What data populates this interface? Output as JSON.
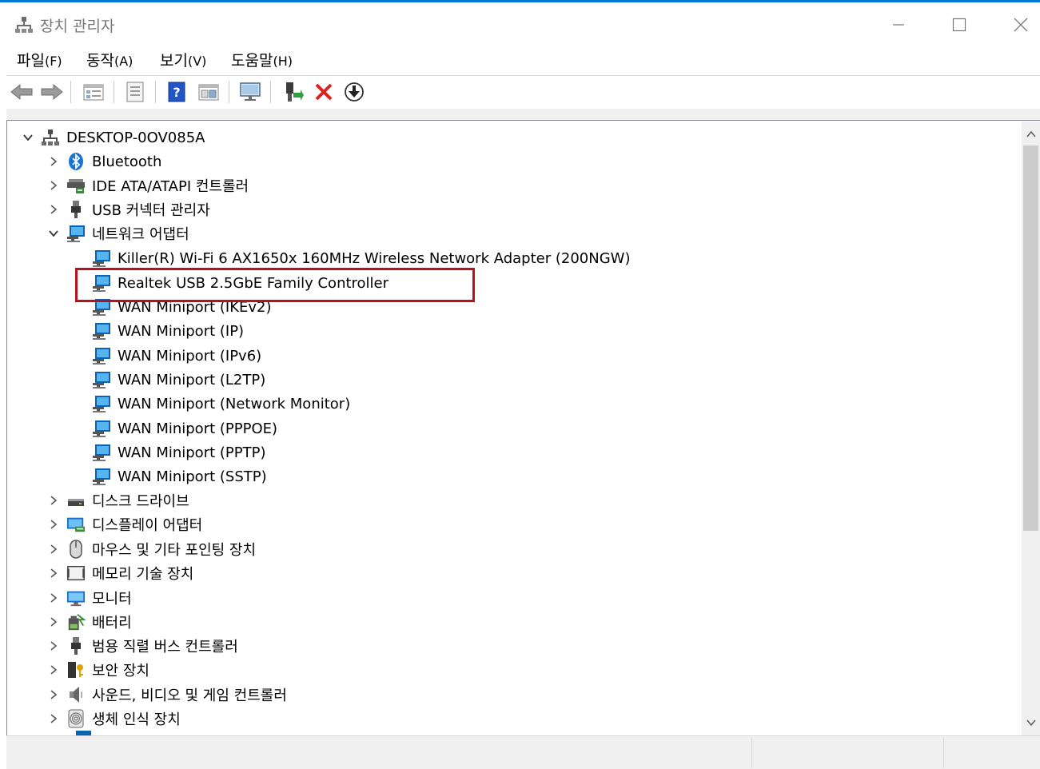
{
  "window": {
    "title": "장치 관리자"
  },
  "menu": [
    {
      "label": "파일",
      "accel": "(F)"
    },
    {
      "label": "동작",
      "accel": "(A)"
    },
    {
      "label": "보기",
      "accel": "(V)"
    },
    {
      "label": "도움말",
      "accel": "(H)"
    }
  ],
  "toolbar": [
    "back-icon",
    "forward-icon",
    "properties-icon",
    "update-list-icon",
    "help-icon",
    "show-hidden-icon",
    "monitor-scan-icon",
    "enable-driver-icon",
    "uninstall-icon",
    "download-driver-icon"
  ],
  "tree": {
    "root": "DESKTOP-0OV085A",
    "categories": [
      {
        "label": "Bluetooth",
        "icon": "bluetooth-icon",
        "expanded": false
      },
      {
        "label": "IDE ATA/ATAPI 컨트롤러",
        "icon": "ide-controller-icon",
        "expanded": false
      },
      {
        "label": "USB 커넥터 관리자",
        "icon": "usb-plug-icon",
        "expanded": false
      },
      {
        "label": "네트워크 어댑터",
        "icon": "network-adapter-icon",
        "expanded": true,
        "children": [
          "Killer(R) Wi-Fi 6 AX1650x 160MHz Wireless Network Adapter (200NGW)",
          "Realtek USB 2.5GbE Family Controller",
          "WAN Miniport (IKEv2)",
          "WAN Miniport (IP)",
          "WAN Miniport (IPv6)",
          "WAN Miniport (L2TP)",
          "WAN Miniport (Network Monitor)",
          "WAN Miniport (PPPOE)",
          "WAN Miniport (PPTP)",
          "WAN Miniport (SSTP)"
        ]
      },
      {
        "label": "디스크 드라이브",
        "icon": "disk-drive-icon",
        "expanded": false
      },
      {
        "label": "디스플레이 어댑터",
        "icon": "display-adapter-icon",
        "expanded": false
      },
      {
        "label": "마우스 및 기타 포인팅 장치",
        "icon": "mouse-icon",
        "expanded": false
      },
      {
        "label": "메모리 기술 장치",
        "icon": "memory-device-icon",
        "expanded": false
      },
      {
        "label": "모니터",
        "icon": "monitor-icon",
        "expanded": false
      },
      {
        "label": "배터리",
        "icon": "battery-icon",
        "expanded": false
      },
      {
        "label": "범용 직렬 버스 컨트롤러",
        "icon": "usb-controller-icon",
        "expanded": false
      },
      {
        "label": "보안 장치",
        "icon": "security-device-icon",
        "expanded": false
      },
      {
        "label": "사운드, 비디오 및 게임 컨트롤러",
        "icon": "sound-icon",
        "expanded": false
      },
      {
        "label": "생체 인식 장치",
        "icon": "biometric-icon",
        "expanded": false
      }
    ]
  },
  "highlight": {
    "target": "Realtek USB 2.5GbE Family Controller",
    "color": "#b5121b"
  },
  "colors": {
    "accent": "#0078d7",
    "pane_border": "#828790",
    "status_bg": "#f0f0f0"
  }
}
